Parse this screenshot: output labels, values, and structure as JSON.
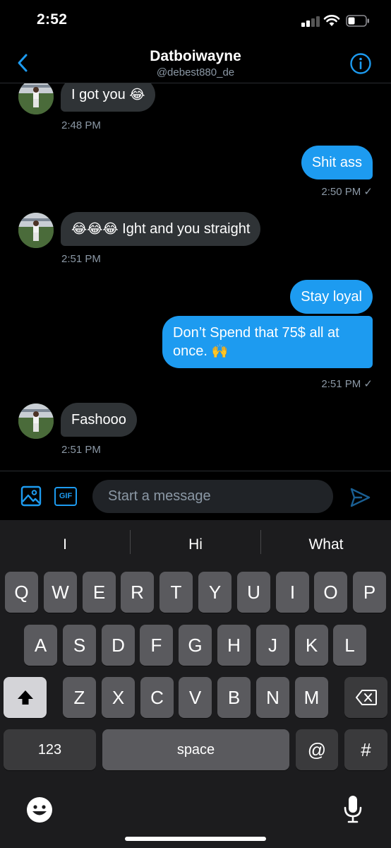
{
  "status_bar": {
    "time": "2:52"
  },
  "header": {
    "title": "Datboiwayne",
    "subtitle": "@debest880_de"
  },
  "messages": [
    {
      "dir": "in",
      "text": "I got you",
      "emoji": "😂",
      "time": "2:48 PM"
    },
    {
      "dir": "out",
      "text": "Shit ass",
      "time": "2:50 PM ✓"
    },
    {
      "dir": "in",
      "emoji_prefix": "😂😂😂",
      "text": "Ight and you straight",
      "time": "2:51 PM"
    },
    {
      "dir": "out",
      "text": "Stay loyal"
    },
    {
      "dir": "out",
      "text": "Don’t Spend that 75$ all at once.",
      "emoji": "🙌",
      "time": "2:51 PM ✓"
    },
    {
      "dir": "in",
      "text": "Fashooo",
      "time": "2:51 PM"
    }
  ],
  "composer": {
    "placeholder": "Start a message",
    "gif_label": "GIF"
  },
  "keyboard": {
    "suggestions": [
      "I",
      "Hi",
      "What"
    ],
    "row1": [
      "Q",
      "W",
      "E",
      "R",
      "T",
      "Y",
      "U",
      "I",
      "O",
      "P"
    ],
    "row2": [
      "A",
      "S",
      "D",
      "F",
      "G",
      "H",
      "J",
      "K",
      "L"
    ],
    "row3": [
      "Z",
      "X",
      "C",
      "V",
      "B",
      "N",
      "M"
    ],
    "numbers_key": "123",
    "space_key": "space",
    "at_key": "@",
    "hash_key": "#"
  },
  "colors": {
    "accent": "#1d9bf0",
    "incoming_bubble": "#2f3336",
    "background": "#000000"
  }
}
